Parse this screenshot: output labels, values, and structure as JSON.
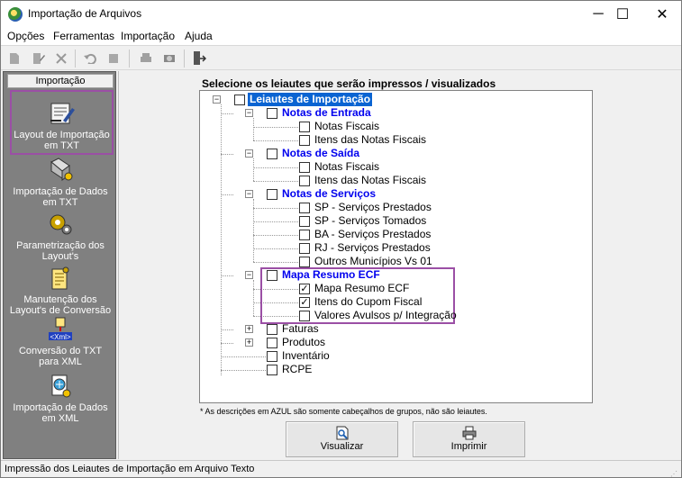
{
  "window": {
    "title": "Importação de Arquivos",
    "controls": [
      "─",
      "☐",
      "✕"
    ]
  },
  "menu": [
    "Opções",
    "Ferramentas",
    "Importação",
    "Ajuda"
  ],
  "sidebar": {
    "header": "Importação",
    "items": [
      {
        "label": "Layout de Importação em TXT",
        "icon": "layout-txt-icon"
      },
      {
        "label": "Importação de Dados em TXT",
        "icon": "import-txt-icon"
      },
      {
        "label": "Parametrização dos Layout's",
        "icon": "parameters-icon"
      },
      {
        "label": "Manutenção dos Layout's de Conversão",
        "icon": "maintenance-icon"
      },
      {
        "label": "Conversão do TXT para XML",
        "icon": "xml-convert-icon"
      },
      {
        "label": "Importação de Dados em XML",
        "icon": "import-xml-icon"
      }
    ]
  },
  "main": {
    "instruction": "Selecione os leiautes que serão impressos / visualizados",
    "tree": {
      "root": "Leiautes de Importação",
      "groups": [
        {
          "label": "Notas de Entrada",
          "children": [
            "Notas Fiscais",
            "Itens das Notas Fiscais"
          ]
        },
        {
          "label": "Notas de Saída",
          "children": [
            "Notas Fiscais",
            "Itens das Notas Fiscais"
          ]
        },
        {
          "label": "Notas de Serviços",
          "children": [
            "SP - Serviços Prestados",
            "SP - Serviços Tomados",
            "BA - Serviços Prestados",
            "RJ - Serviços Prestados",
            "Outros Municípios Vs 01"
          ]
        },
        {
          "label": "Mapa Resumo ECF",
          "children": [
            "Mapa Resumo ECF",
            "Itens do Cupom Fiscal",
            "Valores Avulsos p/ Integração"
          ]
        }
      ],
      "others": [
        "Faturas",
        "Produtos",
        "Inventário",
        "RCPE"
      ]
    },
    "note": "* As descrições em AZUL são somente cabeçalhos de grupos, não são leiautes.",
    "buttons": {
      "preview": "Visualizar",
      "print": "Imprimir"
    }
  },
  "status": "Impressão dos Leiautes de Importação em Arquivo Texto",
  "colors": {
    "group_text": "#0000ee",
    "selection": "#0a64d2",
    "highlight": "#9b4fa5",
    "sidebar_bg": "#808080"
  }
}
